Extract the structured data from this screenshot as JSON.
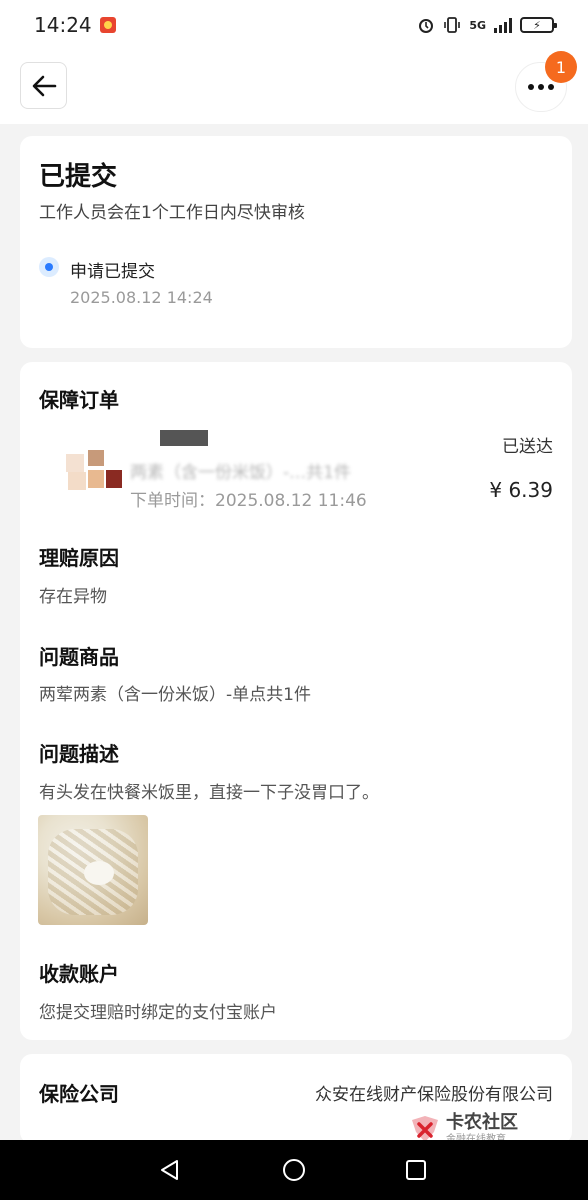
{
  "status_bar": {
    "time": "14:24",
    "network": "5G",
    "battery_icon": "battery-charging-icon"
  },
  "header": {
    "back_icon": "arrow-left-icon",
    "more_icon": "more-dots-icon",
    "notification_count": "1"
  },
  "status_card": {
    "title": "已提交",
    "subtitle": "工作人员会在1个工作日内尽快审核",
    "steps": [
      {
        "label": "申请已提交",
        "time": "2025.08.12 14:24"
      }
    ]
  },
  "order_card": {
    "section_title": "保障订单",
    "order": {
      "name": "两素（含一份米饭）-…共1件",
      "time_label": "下单时间：2025.08.12 11:46",
      "status": "已送达",
      "price": "¥ 6.39"
    },
    "claim_reason": {
      "title": "理赔原因",
      "value": "存在异物"
    },
    "problem_item": {
      "title": "问题商品",
      "value": "两荤两素（含一份米饭）-单点共1件"
    },
    "problem_desc": {
      "title": "问题描述",
      "value": "有头发在快餐米饭里，直接一下子没胃口了。"
    },
    "payout_account": {
      "title": "收款账户",
      "value": "您提交理赔时绑定的支付宝账户"
    }
  },
  "insurance_card": {
    "label": "保险公司",
    "value": "众安在线财产保险股份有限公司"
  },
  "watermark": {
    "main": "卡农社区",
    "sub": "金融在线教育"
  },
  "colors": {
    "accent_blue": "#2a7bff",
    "badge_orange": "#f56a1e",
    "background": "#f3f3f3"
  }
}
